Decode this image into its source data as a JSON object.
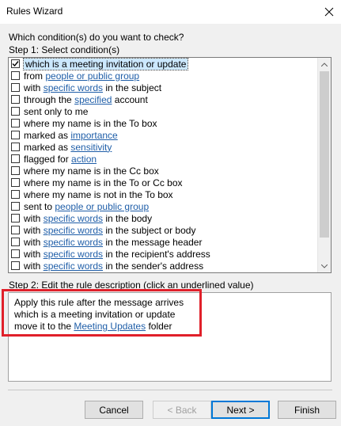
{
  "window": {
    "title": "Rules Wizard"
  },
  "question": "Which condition(s) do you want to check?",
  "step1_label": "Step 1: Select condition(s)",
  "conditions": [
    {
      "checked": true,
      "selected": true,
      "parts": [
        {
          "t": "which is a meeting invitation or update"
        }
      ]
    },
    {
      "checked": false,
      "parts": [
        {
          "t": "from "
        },
        {
          "t": "people or public group",
          "link": true
        }
      ]
    },
    {
      "checked": false,
      "parts": [
        {
          "t": "with "
        },
        {
          "t": "specific words",
          "link": true
        },
        {
          "t": " in the subject"
        }
      ]
    },
    {
      "checked": false,
      "parts": [
        {
          "t": "through the "
        },
        {
          "t": "specified",
          "link": true
        },
        {
          "t": " account"
        }
      ]
    },
    {
      "checked": false,
      "parts": [
        {
          "t": "sent only to me"
        }
      ]
    },
    {
      "checked": false,
      "parts": [
        {
          "t": "where my name is in the To box"
        }
      ]
    },
    {
      "checked": false,
      "parts": [
        {
          "t": "marked as "
        },
        {
          "t": "importance",
          "link": true
        }
      ]
    },
    {
      "checked": false,
      "parts": [
        {
          "t": "marked as "
        },
        {
          "t": "sensitivity",
          "link": true
        }
      ]
    },
    {
      "checked": false,
      "parts": [
        {
          "t": "flagged for "
        },
        {
          "t": "action",
          "link": true
        }
      ]
    },
    {
      "checked": false,
      "parts": [
        {
          "t": "where my name is in the Cc box"
        }
      ]
    },
    {
      "checked": false,
      "parts": [
        {
          "t": "where my name is in the To or Cc box"
        }
      ]
    },
    {
      "checked": false,
      "parts": [
        {
          "t": "where my name is not in the To box"
        }
      ]
    },
    {
      "checked": false,
      "parts": [
        {
          "t": "sent to "
        },
        {
          "t": "people or public group",
          "link": true
        }
      ]
    },
    {
      "checked": false,
      "parts": [
        {
          "t": "with "
        },
        {
          "t": "specific words",
          "link": true
        },
        {
          "t": " in the body"
        }
      ]
    },
    {
      "checked": false,
      "parts": [
        {
          "t": "with "
        },
        {
          "t": "specific words",
          "link": true
        },
        {
          "t": " in the subject or body"
        }
      ]
    },
    {
      "checked": false,
      "parts": [
        {
          "t": "with "
        },
        {
          "t": "specific words",
          "link": true
        },
        {
          "t": " in the message header"
        }
      ]
    },
    {
      "checked": false,
      "parts": [
        {
          "t": "with "
        },
        {
          "t": "specific words",
          "link": true
        },
        {
          "t": " in the recipient's address"
        }
      ]
    },
    {
      "checked": false,
      "parts": [
        {
          "t": "with "
        },
        {
          "t": "specific words",
          "link": true
        },
        {
          "t": " in the sender's address"
        }
      ]
    }
  ],
  "step2_label": "Step 2: Edit the rule description (click an underlined value)",
  "description": {
    "line1": "Apply this rule after the message arrives",
    "line2": "which is a meeting invitation or update",
    "line3_pre": "move it to the ",
    "line3_link": "Meeting Updates",
    "line3_post": " folder"
  },
  "buttons": {
    "cancel": "Cancel",
    "back": "< Back",
    "next": "Next >",
    "finish": "Finish"
  },
  "colors": {
    "link": "#1f5ea8",
    "highlight_box": "#e0202a",
    "selection": "#cce8ff"
  },
  "icons": {
    "close": "close-icon",
    "check": "checkmark-icon",
    "scroll_up": "chevron-up-icon",
    "scroll_down": "chevron-down-icon"
  }
}
